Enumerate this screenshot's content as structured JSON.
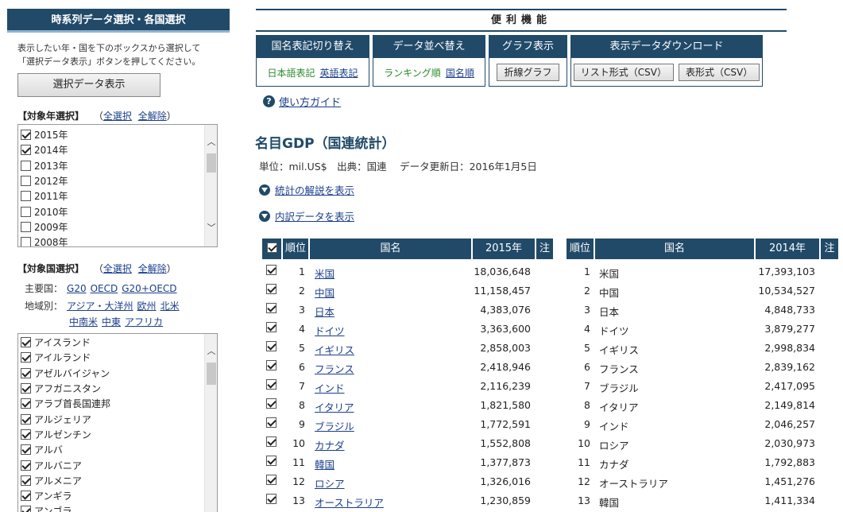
{
  "sidebar": {
    "title": "時系列データ選択・各国選択",
    "desc_line1": "表示したい年・国を下のボックスから選択して",
    "desc_line2": "「選択データ表示」ボタンを押してください。",
    "show_button": "選択データ表示",
    "year_section": {
      "label": "【対象年選択】",
      "select_all": "全選択",
      "clear_all": "全解除"
    },
    "years": [
      {
        "label": "2015年",
        "checked": true
      },
      {
        "label": "2014年",
        "checked": true
      },
      {
        "label": "2013年",
        "checked": false
      },
      {
        "label": "2012年",
        "checked": false
      },
      {
        "label": "2011年",
        "checked": false
      },
      {
        "label": "2010年",
        "checked": false
      },
      {
        "label": "2009年",
        "checked": false
      },
      {
        "label": "2008年",
        "checked": false
      }
    ],
    "country_section": {
      "label": "【対象国選択】",
      "select_all": "全選択",
      "clear_all": "全解除"
    },
    "major_label": "主要国：",
    "major_links": [
      "G20",
      "OECD",
      "G20+OECD"
    ],
    "region_label": "地域別：",
    "region_links_1": [
      "アジア・大洋州",
      "欧州",
      "北米"
    ],
    "region_links_2": [
      "中南米",
      "中東",
      "アフリカ"
    ],
    "countries": [
      {
        "label": "アイスランド",
        "checked": true
      },
      {
        "label": "アイルランド",
        "checked": true
      },
      {
        "label": "アゼルバイジャン",
        "checked": true
      },
      {
        "label": "アフガニスタン",
        "checked": true
      },
      {
        "label": "アラブ首長国連邦",
        "checked": true
      },
      {
        "label": "アルジェリア",
        "checked": true
      },
      {
        "label": "アルゼンチン",
        "checked": true
      },
      {
        "label": "アルバ",
        "checked": true
      },
      {
        "label": "アルバニア",
        "checked": true
      },
      {
        "label": "アルメニア",
        "checked": true
      },
      {
        "label": "アンギラ",
        "checked": true
      },
      {
        "label": "アンゴラ",
        "checked": true
      }
    ]
  },
  "utility": {
    "title": "便利機能",
    "name_switch": {
      "header": "国名表記切り替え",
      "current": "日本語表記",
      "other": "英語表記"
    },
    "sort_switch": {
      "header": "データ並べ替え",
      "current": "ランキング順",
      "other": "国名順"
    },
    "graph": {
      "header": "グラフ表示",
      "button": "折線グラフ"
    },
    "download": {
      "header": "表示データダウンロード",
      "list_button": "リスト形式（CSV）",
      "table_button": "表形式（CSV）"
    }
  },
  "guide_link": "使い方ガイド",
  "page_title": "名目GDP（国連統計）",
  "unit_line": "単位：mil.US$　出典：国連　 データ更新日：2016年1月5日",
  "expand_stats": "統計の解説を表示",
  "expand_breakdown": "内訳データを表示",
  "table": {
    "headers": {
      "rank": "順位",
      "name": "国名",
      "note": "注"
    },
    "year_a": "2015年",
    "year_b": "2014年",
    "rows_a": [
      {
        "rank": "1",
        "name": "米国",
        "value": "18,036,648"
      },
      {
        "rank": "2",
        "name": "中国",
        "value": "11,158,457"
      },
      {
        "rank": "3",
        "name": "日本",
        "value": "4,383,076"
      },
      {
        "rank": "4",
        "name": "ドイツ",
        "value": "3,363,600"
      },
      {
        "rank": "5",
        "name": "イギリス",
        "value": "2,858,003"
      },
      {
        "rank": "6",
        "name": "フランス",
        "value": "2,418,946"
      },
      {
        "rank": "7",
        "name": "インド",
        "value": "2,116,239"
      },
      {
        "rank": "8",
        "name": "イタリア",
        "value": "1,821,580"
      },
      {
        "rank": "9",
        "name": "ブラジル",
        "value": "1,772,591"
      },
      {
        "rank": "10",
        "name": "カナダ",
        "value": "1,552,808"
      },
      {
        "rank": "11",
        "name": "韓国",
        "value": "1,377,873"
      },
      {
        "rank": "12",
        "name": "ロシア",
        "value": "1,326,016"
      },
      {
        "rank": "13",
        "name": "オーストラリア",
        "value": "1,230,859"
      }
    ],
    "rows_b": [
      {
        "rank": "1",
        "name": "米国",
        "value": "17,393,103"
      },
      {
        "rank": "2",
        "name": "中国",
        "value": "10,534,527"
      },
      {
        "rank": "3",
        "name": "日本",
        "value": "4,848,733"
      },
      {
        "rank": "4",
        "name": "ドイツ",
        "value": "3,879,277"
      },
      {
        "rank": "5",
        "name": "イギリス",
        "value": "2,998,834"
      },
      {
        "rank": "6",
        "name": "フランス",
        "value": "2,839,162"
      },
      {
        "rank": "7",
        "name": "ブラジル",
        "value": "2,417,095"
      },
      {
        "rank": "8",
        "name": "イタリア",
        "value": "2,149,814"
      },
      {
        "rank": "9",
        "name": "インド",
        "value": "2,046,257"
      },
      {
        "rank": "10",
        "name": "ロシア",
        "value": "2,030,973"
      },
      {
        "rank": "11",
        "name": "カナダ",
        "value": "1,792,883"
      },
      {
        "rank": "12",
        "name": "オーストラリア",
        "value": "1,451,276"
      },
      {
        "rank": "13",
        "name": "韓国",
        "value": "1,411,334"
      }
    ]
  }
}
